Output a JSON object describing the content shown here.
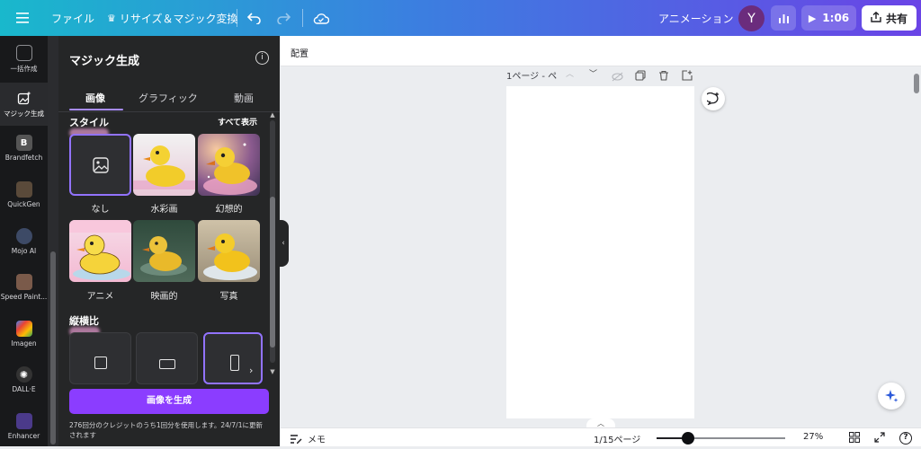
{
  "topbar": {
    "menu_icon": "hamburger-menu-icon",
    "file": "ファイル",
    "resize": "リサイズ＆マジック変換",
    "crown_icon": "crown-icon",
    "undo_icon": "undo-icon",
    "redo_icon": "redo-icon",
    "cloud_icon": "cloud-save-icon",
    "animation": "アニメーション",
    "avatar_initial": "Y",
    "avatar_color": "#6b2c7d",
    "insights_icon": "bar-chart-icon",
    "play_time": "1:06",
    "share": "共有"
  },
  "rail": {
    "items": [
      {
        "label": "一括作成",
        "icon": "bulk-create-icon",
        "color": "#444549"
      },
      {
        "label": "マジック生成",
        "icon": "magic-media-icon",
        "color": "#3a3b3e"
      },
      {
        "label": "Brandfetch",
        "icon": "brandfetch-icon",
        "color": "#555"
      },
      {
        "label": "QuickGen",
        "icon": "quickgen-icon",
        "color": "#5a4a3a"
      },
      {
        "label": "Mojo AI",
        "icon": "mojo-ai-icon",
        "color": "#3d4a66"
      },
      {
        "label": "Speed Paint...",
        "icon": "speed-paint-icon",
        "color": "#7a5a4a"
      },
      {
        "label": "Imagen",
        "icon": "imagen-icon",
        "color": "#3a5a9a"
      },
      {
        "label": "DALL·E",
        "icon": "dalle-icon",
        "color": "#333"
      },
      {
        "label": "Enhancer",
        "icon": "enhancer-icon",
        "color": "#4b3a8a"
      }
    ],
    "active_index": 1
  },
  "panel": {
    "title": "マジック生成",
    "tabs": [
      "画像",
      "グラフィック",
      "動画"
    ],
    "active_tab": 0,
    "style_title": "スタイル",
    "show_all": "すべて表示",
    "styles": [
      {
        "label": "なし",
        "selected": true
      },
      {
        "label": "水彩画",
        "selected": false
      },
      {
        "label": "幻想的",
        "selected": false
      },
      {
        "label": "アニメ",
        "selected": false
      },
      {
        "label": "映画的",
        "selected": false
      },
      {
        "label": "写真",
        "selected": false
      }
    ],
    "aspect_title": "縦横比",
    "aspect_options": [
      "square",
      "landscape",
      "portrait"
    ],
    "aspect_selected": 2,
    "generate_button": "画像を生成",
    "credits_text": "276回分のクレジットのうち1回分を使用します。24/7/1に更新されます"
  },
  "canvas": {
    "context_label": "配置",
    "page_title": "1ページ - ペ"
  },
  "bottombar": {
    "notes": "メモ",
    "page_count": "1/15ページ",
    "zoom": "27%",
    "zoom_fraction": 0.27
  },
  "colors": {
    "accent": "#8b3dff",
    "selection": "#9273ff"
  }
}
